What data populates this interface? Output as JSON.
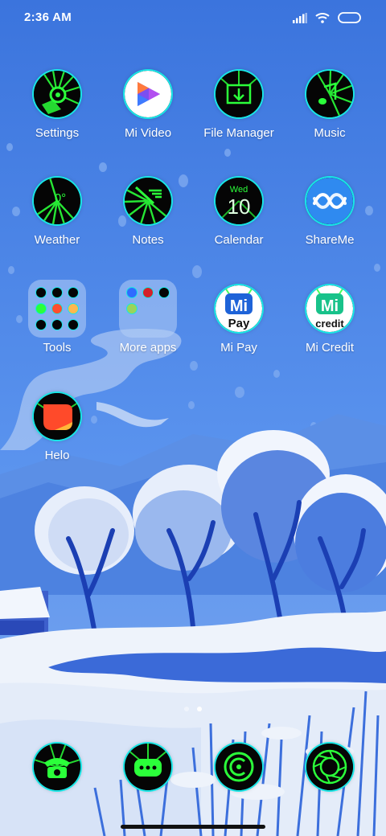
{
  "status_bar": {
    "time": "2:36 AM",
    "icons": [
      "signal-icon",
      "wifi-icon",
      "battery-icon"
    ]
  },
  "apps": {
    "settings": {
      "label": "Settings",
      "icon": "settings-icon"
    },
    "mi_video": {
      "label": "Mi Video",
      "icon": "mi-video-icon"
    },
    "file_manager": {
      "label": "File Manager",
      "icon": "file-manager-icon"
    },
    "music": {
      "label": "Music",
      "icon": "music-icon"
    },
    "weather": {
      "label": "Weather",
      "icon": "weather-icon",
      "value": "0°"
    },
    "notes": {
      "label": "Notes",
      "icon": "notes-icon"
    },
    "calendar": {
      "label": "Calendar",
      "icon": "calendar-icon",
      "day": "Wed",
      "date": "10"
    },
    "shareme": {
      "label": "ShareMe",
      "icon": "shareme-icon"
    },
    "tools": {
      "label": "Tools",
      "icon": "folder-icon"
    },
    "more_apps": {
      "label": "More apps",
      "icon": "folder-icon"
    },
    "mi_pay": {
      "label": "Mi Pay",
      "icon": "mi-pay-icon",
      "icon_text_top": "Mi",
      "icon_text_bottom": "Pay"
    },
    "mi_credit": {
      "label": "Mi Credit",
      "icon": "mi-credit-icon",
      "icon_text_top": "Mi",
      "icon_text_bottom": "credit"
    },
    "helo": {
      "label": "Helo",
      "icon": "helo-icon"
    }
  },
  "dock": [
    "phone-icon",
    "messages-icon",
    "browser-icon",
    "camera-icon"
  ],
  "page_indicator": {
    "count": 2,
    "active": 2
  },
  "colors": {
    "accent_ring": "#18e6e6",
    "icon_glow": "#2bff3a",
    "sky": "#3f7be0",
    "snow": "#eef3fb"
  }
}
